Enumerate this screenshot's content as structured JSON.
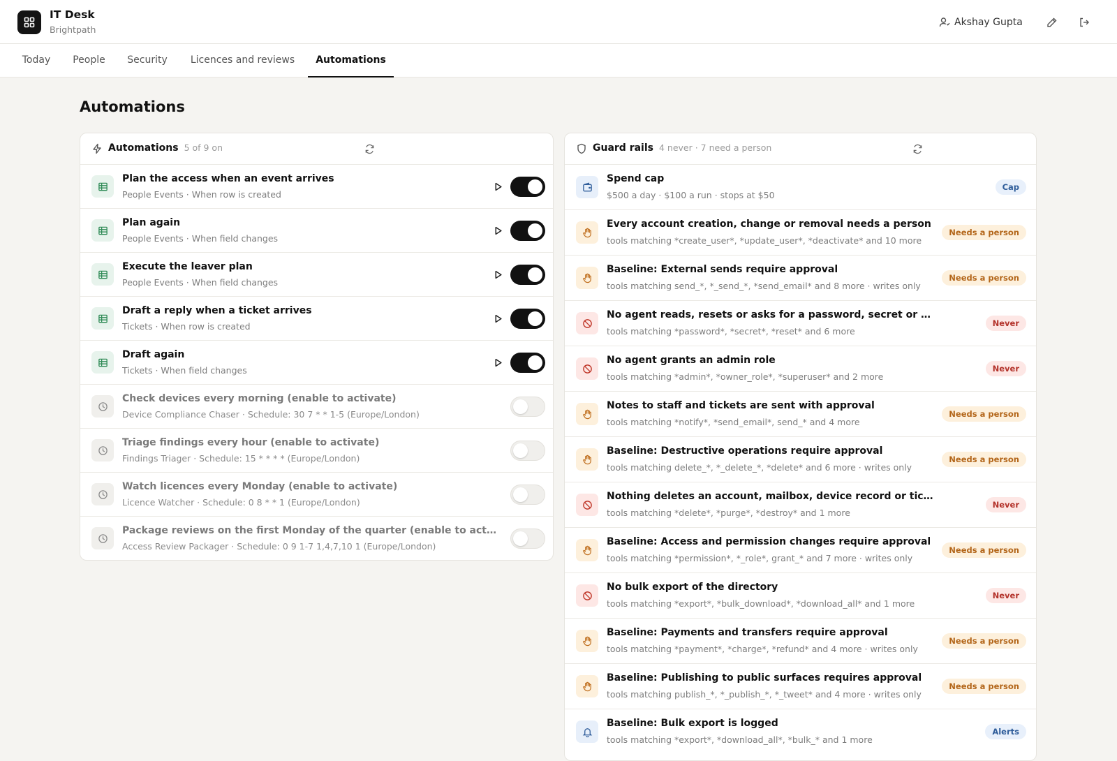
{
  "app": {
    "title": "IT Desk",
    "subtitle": "Brightpath",
    "user_name": "Akshay Gupta"
  },
  "tabs": [
    {
      "label": "Today",
      "active": false
    },
    {
      "label": "People",
      "active": false
    },
    {
      "label": "Security",
      "active": false
    },
    {
      "label": "Licences and reviews",
      "active": false
    },
    {
      "label": "Automations",
      "active": true
    }
  ],
  "page": {
    "title": "Automations"
  },
  "automations": {
    "title": "Automations",
    "meta": "5 of 9 on",
    "items": [
      {
        "title": "Plan the access when an event arrives",
        "subtitle": "People Events · When row is created",
        "enabled": true,
        "icon": "table-icon"
      },
      {
        "title": "Plan again",
        "subtitle": "People Events · When field changes",
        "enabled": true,
        "icon": "table-icon"
      },
      {
        "title": "Execute the leaver plan",
        "subtitle": "People Events · When field changes",
        "enabled": true,
        "icon": "table-icon"
      },
      {
        "title": "Draft a reply when a ticket arrives",
        "subtitle": "Tickets · When row is created",
        "enabled": true,
        "icon": "table-icon"
      },
      {
        "title": "Draft again",
        "subtitle": "Tickets · When field changes",
        "enabled": true,
        "icon": "table-icon"
      },
      {
        "title": "Check devices every morning (enable to activate)",
        "subtitle": "Device Compliance Chaser · Schedule: 30 7 * * 1-5 (Europe/London)",
        "enabled": false,
        "icon": "clock-icon"
      },
      {
        "title": "Triage findings every hour (enable to activate)",
        "subtitle": "Findings Triager · Schedule: 15 * * * * (Europe/London)",
        "enabled": false,
        "icon": "clock-icon"
      },
      {
        "title": "Watch licences every Monday (enable to activate)",
        "subtitle": "Licence Watcher · Schedule: 0 8 * * 1 (Europe/London)",
        "enabled": false,
        "icon": "clock-icon"
      },
      {
        "title": "Package reviews on the first Monday of the quarter (enable to activat…",
        "subtitle": "Access Review Packager · Schedule: 0 9 1-7 1,4,7,10 1 (Europe/London)",
        "enabled": false,
        "icon": "clock-icon"
      }
    ]
  },
  "guardrails": {
    "title": "Guard rails",
    "meta": "4 never · 7 need a person",
    "items": [
      {
        "title": "Spend cap",
        "subtitle": "$500 a day · $100 a run · stops at $50",
        "badge": "Cap",
        "kind": "cap",
        "icon": "wallet-icon"
      },
      {
        "title": "Every account creation, change or removal needs a person",
        "subtitle": "tools matching *create_user*, *update_user*, *deactivate* and 10 more",
        "badge": "Needs a person",
        "kind": "person",
        "icon": "hand-icon"
      },
      {
        "title": "Baseline: External sends require approval",
        "subtitle": "tools matching send_*, *_send_*, *send_email* and 8 more · writes only",
        "badge": "Needs a person",
        "kind": "person",
        "icon": "hand-icon"
      },
      {
        "title": "No agent reads, resets or asks for a password, secret or MFA",
        "subtitle": "tools matching *password*, *secret*, *reset* and 6 more",
        "badge": "Never",
        "kind": "never",
        "icon": "ban-icon"
      },
      {
        "title": "No agent grants an admin role",
        "subtitle": "tools matching *admin*, *owner_role*, *superuser* and 2 more",
        "badge": "Never",
        "kind": "never",
        "icon": "ban-icon"
      },
      {
        "title": "Notes to staff and tickets are sent with approval",
        "subtitle": "tools matching *notify*, *send_email*, send_* and 4 more",
        "badge": "Needs a person",
        "kind": "person",
        "icon": "hand-icon"
      },
      {
        "title": "Baseline: Destructive operations require approval",
        "subtitle": "tools matching delete_*, *_delete_*, *delete* and 6 more · writes only",
        "badge": "Needs a person",
        "kind": "person",
        "icon": "hand-icon"
      },
      {
        "title": "Nothing deletes an account, mailbox, device record or ticket",
        "subtitle": "tools matching *delete*, *purge*, *destroy* and 1 more",
        "badge": "Never",
        "kind": "never",
        "icon": "ban-icon"
      },
      {
        "title": "Baseline: Access and permission changes require approval",
        "subtitle": "tools matching *permission*, *_role*, grant_* and 7 more · writes only",
        "badge": "Needs a person",
        "kind": "person",
        "icon": "hand-icon"
      },
      {
        "title": "No bulk export of the directory",
        "subtitle": "tools matching *export*, *bulk_download*, *download_all* and 1 more",
        "badge": "Never",
        "kind": "never",
        "icon": "ban-icon"
      },
      {
        "title": "Baseline: Payments and transfers require approval",
        "subtitle": "tools matching *payment*, *charge*, *refund* and 4 more · writes only",
        "badge": "Needs a person",
        "kind": "person",
        "icon": "hand-icon"
      },
      {
        "title": "Baseline: Publishing to public surfaces requires approval",
        "subtitle": "tools matching publish_*, *_publish_*, *_tweet* and 4 more · writes only",
        "badge": "Needs a person",
        "kind": "person",
        "icon": "hand-icon"
      },
      {
        "title": "Baseline: Bulk export is logged",
        "subtitle": "tools matching *export*, *download_all*, *bulk_* and 1 more",
        "badge": "Alerts",
        "kind": "alerts",
        "icon": "bell-icon"
      }
    ]
  },
  "colors": {
    "accent": "#111111",
    "background": "#f5f4f1",
    "needs_person": "#b3661a",
    "never": "#b3322a",
    "cap": "#2f5d9a"
  }
}
